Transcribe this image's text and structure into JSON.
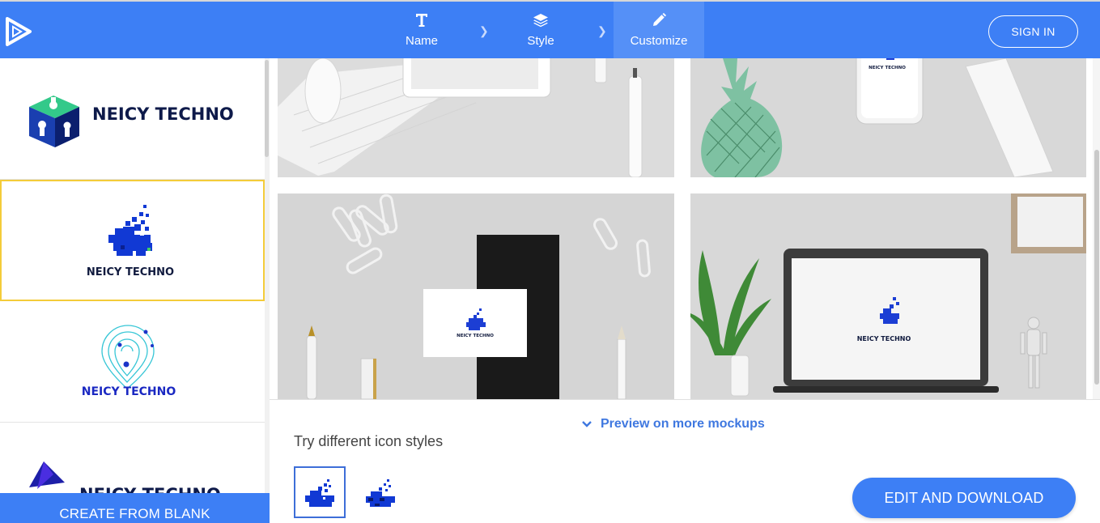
{
  "header": {
    "steps": [
      {
        "label": "Name",
        "icon": "text-icon"
      },
      {
        "label": "Style",
        "icon": "layers-icon"
      },
      {
        "label": "Customize",
        "icon": "pencil-icon"
      }
    ],
    "active_step": "Customize",
    "sign_in_label": "SIGN IN",
    "accent": "#3d7ff5"
  },
  "sidebar": {
    "logos": [
      {
        "text": "NEICY TECHNO",
        "style": "cube-keyhole"
      },
      {
        "text": "NEICY TECHNO",
        "style": "pixel-blob",
        "selected": true
      },
      {
        "text": "NEICY TECHNO",
        "style": "fingerprint-pin"
      },
      {
        "text": "NEICY TECHNO",
        "style": "folded-triangle"
      }
    ],
    "create_label": "CREATE FROM BLANK"
  },
  "mockups": {
    "card_brand": "NEICY TECHNO",
    "laptop_brand": "NEICY TECHNO"
  },
  "bottom": {
    "preview_label": "Preview on more mockups",
    "try_label": "Try different icon styles",
    "edit_label": "EDIT AND DOWNLOAD"
  }
}
